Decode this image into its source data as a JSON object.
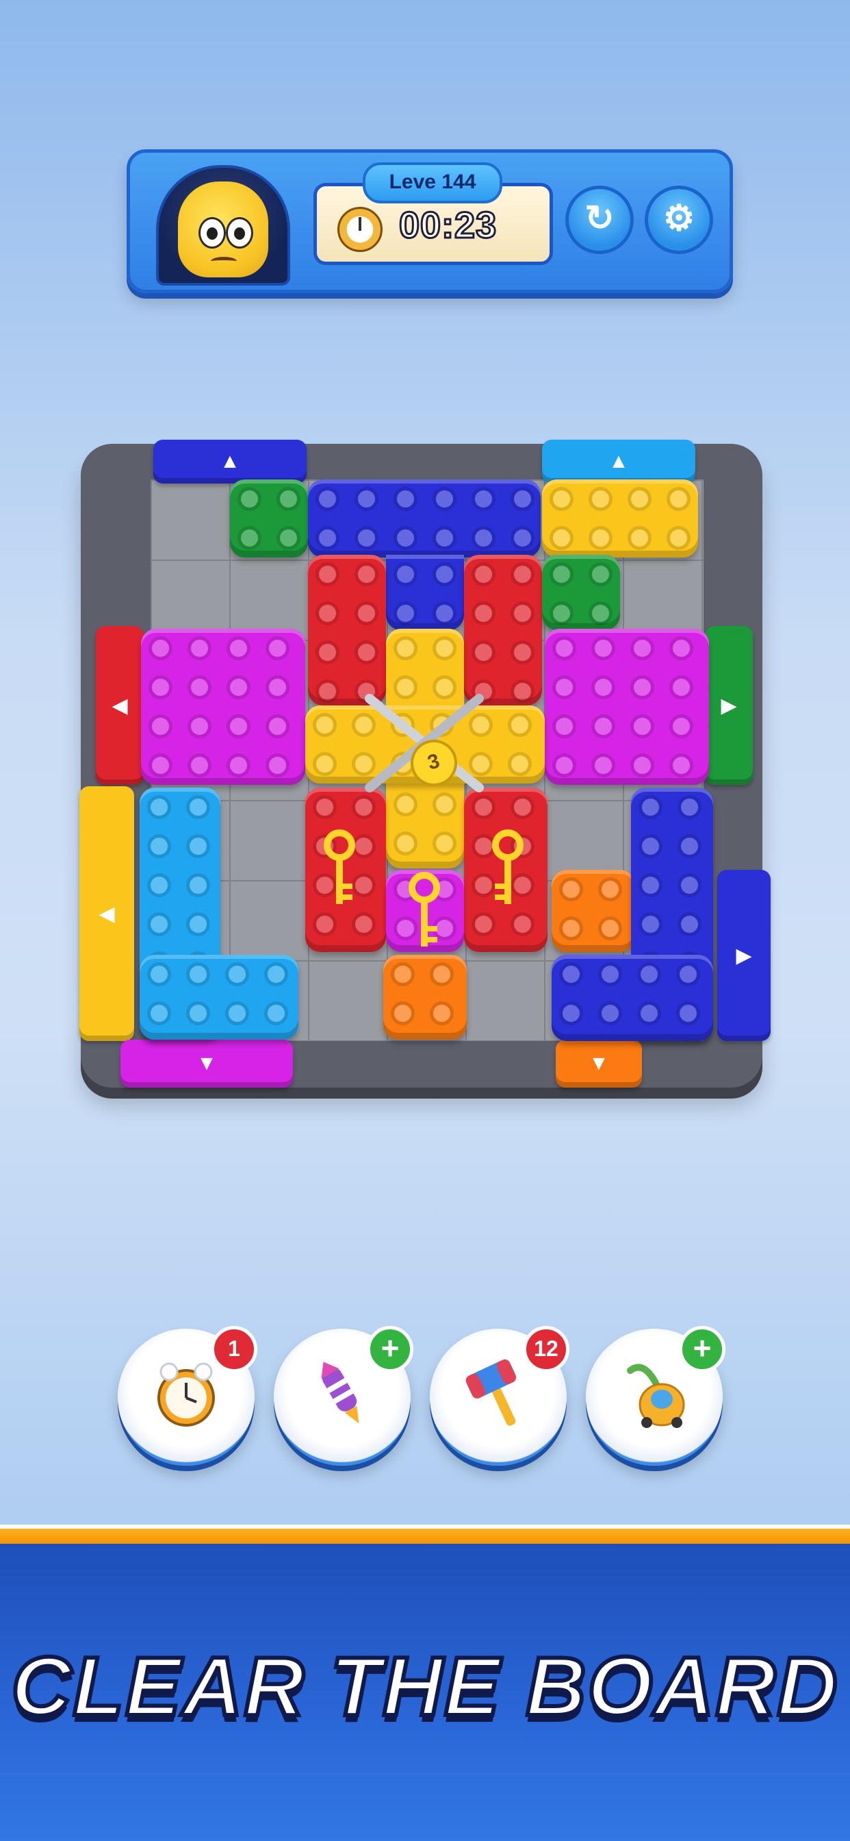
{
  "hud": {
    "level_label": "Leve 144",
    "timer": "00:23",
    "refresh_icon": "↻",
    "settings_icon": "⚙"
  },
  "board": {
    "lock_counter": "3",
    "gate_arrow_up": "▲",
    "gate_arrow_down": "▼",
    "gate_arrow_left": "◀",
    "gate_arrow_right": "▶",
    "colors": {
      "red": "#e0242e",
      "blue": "#2a2fd6",
      "cyan": "#20a6f0",
      "yellow": "#fbc61c",
      "green": "#1c9a3a",
      "magenta": "#d524e6",
      "orange": "#fb7a12",
      "frame": "#5d5f6b"
    }
  },
  "boosters": [
    {
      "name": "alarm-clock-icon",
      "badge": "1",
      "badge_type": "count"
    },
    {
      "name": "rocket-icon",
      "badge": "+",
      "badge_type": "plus"
    },
    {
      "name": "hammer-icon",
      "badge": "12",
      "badge_type": "count"
    },
    {
      "name": "vacuum-icon",
      "badge": "+",
      "badge_type": "plus"
    }
  ],
  "footer": {
    "title": "CLEAR THE BOARD"
  }
}
